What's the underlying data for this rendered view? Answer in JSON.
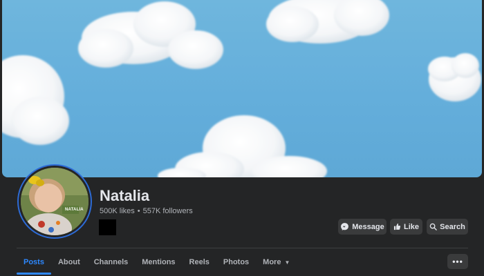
{
  "page": {
    "name": "Natalia",
    "likes": "500K likes",
    "separator": "•",
    "followers": "557K followers",
    "avatar_badge": "NATALIA"
  },
  "actions": {
    "message_label": "Message",
    "like_label": "Like",
    "search_label": "Search",
    "more_dots": "•••"
  },
  "tabs": [
    {
      "label": "Posts",
      "active": true
    },
    {
      "label": "About"
    },
    {
      "label": "Channels"
    },
    {
      "label": "Mentions"
    },
    {
      "label": "Reels"
    },
    {
      "label": "Photos"
    },
    {
      "label": "More"
    }
  ],
  "icons": {
    "messenger": "messenger-icon",
    "like": "thumbs-up-icon",
    "search": "search-icon",
    "caret": "caret-down-icon"
  },
  "colors": {
    "background": "#242526",
    "accent": "#2d88ff",
    "avatar_ring": "#2d6bd6",
    "button_bg": "#3a3b3c",
    "sky": "#64aedb"
  }
}
